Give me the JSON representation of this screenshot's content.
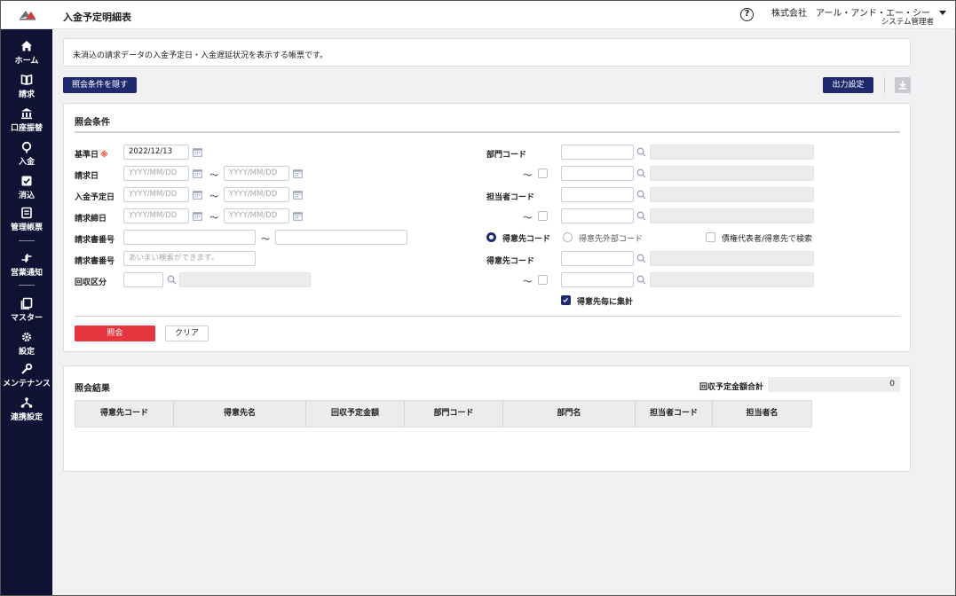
{
  "header": {
    "page_title": "入金予定明細表",
    "company": "株式会社　アール・アンド・エー・シー",
    "user_role": "システム管理者"
  },
  "sidebar": {
    "items": [
      {
        "label": "ホーム",
        "icon": "home-icon"
      },
      {
        "label": "請求",
        "icon": "book-icon"
      },
      {
        "label": "口座振替",
        "icon": "bank-icon"
      },
      {
        "label": "入金",
        "icon": "location-pin-icon"
      },
      {
        "label": "消込",
        "icon": "check-square-icon"
      },
      {
        "label": "管理帳票",
        "icon": "report-icon"
      },
      {
        "label": "営業通知",
        "icon": "arrows-icon"
      },
      {
        "label": "マスター",
        "icon": "stack-icon"
      },
      {
        "label": "設定",
        "icon": "gear-icon"
      },
      {
        "label": "メンテナンス",
        "icon": "wrench-icon"
      },
      {
        "label": "連携設定",
        "icon": "network-icon"
      }
    ]
  },
  "description": "未消込の請求データの入金予定日・入金遅延状況を表示する帳票です。",
  "toolbar": {
    "toggle_conditions": "照会条件を隠す",
    "output_settings": "出力設定"
  },
  "conditions": {
    "title": "照会条件",
    "base_date": {
      "label": "基準日",
      "required_mark": "※",
      "value": "2022/12/13"
    },
    "billing_date": {
      "label": "請求日",
      "from_placeholder": "YYYY/MM/DD",
      "to_placeholder": "YYYY/MM/DD"
    },
    "payment_due_date": {
      "label": "入金予定日",
      "from_placeholder": "YYYY/MM/DD",
      "to_placeholder": "YYYY/MM/DD"
    },
    "billing_close_date": {
      "label": "請求締日",
      "from_placeholder": "YYYY/MM/DD",
      "to_placeholder": "YYYY/MM/DD"
    },
    "invoice_number_range": {
      "label": "請求書番号",
      "from": "",
      "to": ""
    },
    "invoice_number_fuzzy": {
      "label": "請求書番号",
      "placeholder": "あいまい検索ができます。"
    },
    "collection_type": {
      "label": "回収区分",
      "code": "",
      "name": ""
    },
    "department_code": {
      "label": "部門コード"
    },
    "staff_code": {
      "label": "担当者コード"
    },
    "customer_code_mode": {
      "options": [
        "得意先コード",
        "得意先外部コード"
      ],
      "selected": "得意先コード",
      "search_by_representative": {
        "label": "債権代表者/得意先で検索",
        "checked": false
      }
    },
    "customer_code": {
      "label": "得意先コード"
    },
    "aggregate_by_customer": {
      "label": "得意先毎に集計",
      "checked": true
    },
    "tilde": "～",
    "query_button": "照会",
    "clear_button": "クリア"
  },
  "results": {
    "title": "照会結果",
    "total_label": "回収予定金額合計",
    "total_value": "0",
    "columns": [
      "得意先コード",
      "得意先名",
      "回収予定金額",
      "部門コード",
      "部門名",
      "担当者コード",
      "担当者名"
    ]
  },
  "colors": {
    "sidebar_bg": "#0f1233",
    "primary_button": "#1f2a6e",
    "query_button": "#e6363d",
    "required_mark": "#e33322"
  }
}
